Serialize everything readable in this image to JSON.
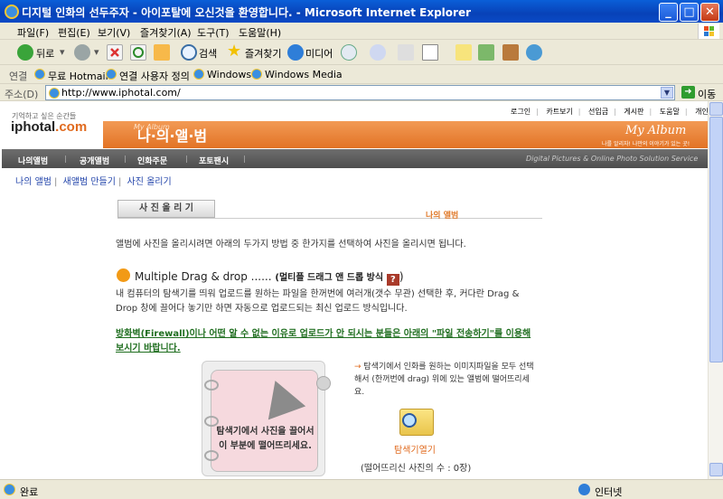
{
  "window": {
    "title": "디지털 인화의 선두주자 - 아이포탈에 오신것을 환영합니다. - Microsoft Internet Explorer"
  },
  "menu": [
    "파일(F)",
    "편집(E)",
    "보기(V)",
    "즐겨찾기(A)",
    "도구(T)",
    "도움말(H)"
  ],
  "toolbar": {
    "back": "뒤로",
    "search": "검색",
    "favorites": "즐겨찾기",
    "media": "미디어"
  },
  "links": {
    "label": "연결",
    "items": [
      "무료 Hotmail",
      "연결 사용자 정의",
      "Windows",
      "Windows Media"
    ]
  },
  "address": {
    "label": "주소(D)",
    "url": "http://www.iphotal.com/",
    "go": "이동"
  },
  "site": {
    "tagline": "기억하고 싶은 순간들",
    "logo_main": "iphotal",
    "logo_dot": ".com",
    "top_links": [
      "로그인",
      "카트보기",
      "선입금",
      "게시판",
      "도움말",
      "개인정보"
    ],
    "album_small": "My Album",
    "album_title": "나·의·앨·범",
    "album_right": "My Album",
    "album_right_tagline": "나를 알리자! 나만의 이야기가 있는 곳!",
    "nav": [
      "나의앨범",
      "공개앨범",
      "인화주문",
      "포토팬시"
    ],
    "nav_tagline": "Digital Pictures & Online Photo Solution Service",
    "subnav": [
      "나의 앨범",
      "새앨범 만들기",
      "사진 올리기"
    ]
  },
  "content": {
    "tab_label": "사 진 올 리 기",
    "tab_right": "나의 앨범",
    "intro": "앨범에 사진을 올리시려면 아래의 두가지 방법 중 한가지를 선택하여 사진을 올리시면 됩니다.",
    "method_title": "Multiple Drag & drop ......",
    "method_kor": "(멀티플 드래그 앤 드롭 방식",
    "method_help": "?",
    "method_close": ")",
    "desc": "내 컴퓨터의 탐색기를 띄워 업로드를 원하는 파일을 한꺼번에 여러개(갯수 무관) 선택한 후, 커다란 Drag & Drop 창에 끌어다 놓기만 하면 자동으로 업로드되는 최신 업로드 방식입니다.",
    "warning": "방화벽(Firewall)이나 어떤 알 수 없는 이유로 업로드가 안 되시는 분들은 아래의 \"파일 전송하기\"를 이용해 보시기 바랍니다.",
    "drop_text": "탐색기에서 사진을 끌어서 이 부분에 떨어뜨리세요.",
    "explain_arrow": "→",
    "explain": "탐색기에서 인화를 원하는 이미지파일을 모두 선택해서 (한꺼번에 drag) 위에 있는 앨범에 떨어뜨리세요.",
    "folder_label": "탐색기열기",
    "count_label": "(떨어뜨리신 사진의 수 : 0장)"
  },
  "status": {
    "left": "완료",
    "right": "인터넷"
  },
  "colors": {
    "accent_orange": "#e27325",
    "title_blue": "#0842b8",
    "warning_green": "#1f6e1f"
  }
}
